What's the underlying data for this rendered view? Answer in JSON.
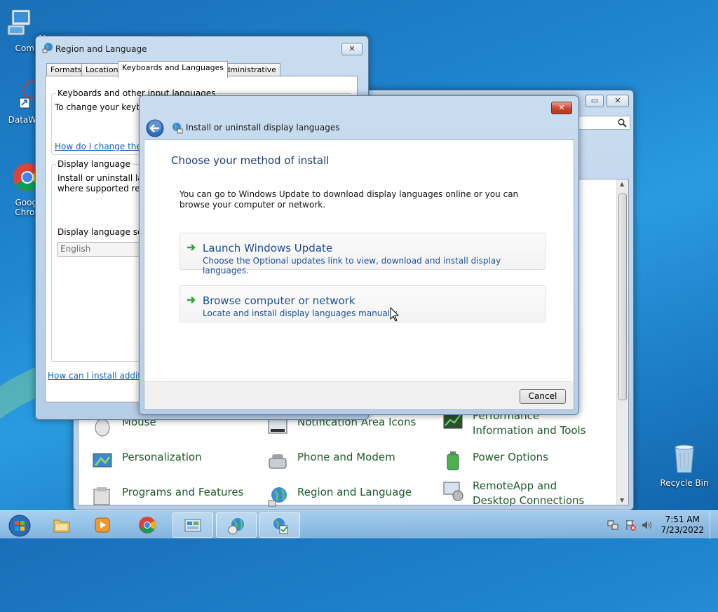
{
  "desktop": {
    "icons": [
      {
        "label": "My Comp",
        "icon": "computer-icon"
      },
      {
        "label": "DataWag",
        "icon": "datawag-icon"
      },
      {
        "label": "Googl\nChron",
        "icon": "chrome-icon"
      },
      {
        "label": "Recycle Bin",
        "icon": "recycle-bin-icon"
      }
    ]
  },
  "control_panel": {
    "items": [
      {
        "label": "Mouse",
        "icon": "mouse-icon"
      },
      {
        "label": "Notification Area Icons",
        "icon": "notification-area-icon"
      },
      {
        "label": "Performance Information and Tools",
        "icon": "performance-icon"
      },
      {
        "label": "Personalization",
        "icon": "personalization-icon"
      },
      {
        "label": "Phone and Modem",
        "icon": "phone-modem-icon"
      },
      {
        "label": "Power Options",
        "icon": "power-options-icon"
      },
      {
        "label": "Programs and Features",
        "icon": "programs-features-icon"
      },
      {
        "label": "Region and Language",
        "icon": "region-language-icon"
      },
      {
        "label": "RemoteApp and Desktop Connections",
        "icon": "remoteapp-icon"
      }
    ]
  },
  "region_language": {
    "title": "Region and Language",
    "tabs": [
      "Formats",
      "Location",
      "Keyboards and Languages",
      "Administrative"
    ],
    "active_tab": 2,
    "keyboards_group_label": "Keyboards and other input languages",
    "keyboards_text": "To change your keyb",
    "keyboards_link": "How do I change the",
    "display_group_label": "Display language",
    "display_text_1": "Install or uninstall la",
    "display_text_2": "where supported rec",
    "display_select_label": "Display language se",
    "display_select_value": "English",
    "bottom_link": "How can I install additi"
  },
  "install_dialog": {
    "title": "Install or uninstall display languages",
    "heading": "Choose your method of install",
    "intro": "You can go to Windows Update to download display languages online or you can browse your computer or network.",
    "options": [
      {
        "title": "Launch Windows Update",
        "desc": "Choose the Optional updates link to view, download and install display languages."
      },
      {
        "title": "Browse computer or network",
        "desc": "Locate and install display languages manually."
      }
    ],
    "cancel_label": "Cancel"
  },
  "taskbar": {
    "buttons": [
      "start-orb-icon",
      "explorer-icon",
      "media-player-icon",
      "chrome-icon",
      "control-panel-icon",
      "region-language-icon",
      "install-languages-icon"
    ],
    "time": "7:51 AM",
    "date": "7/23/2022"
  },
  "colors": {
    "link": "#0b5fb0",
    "option_text": "#1a4e95",
    "cp_item_text": "#1e5a2a",
    "heading": "#1e3d6e"
  }
}
